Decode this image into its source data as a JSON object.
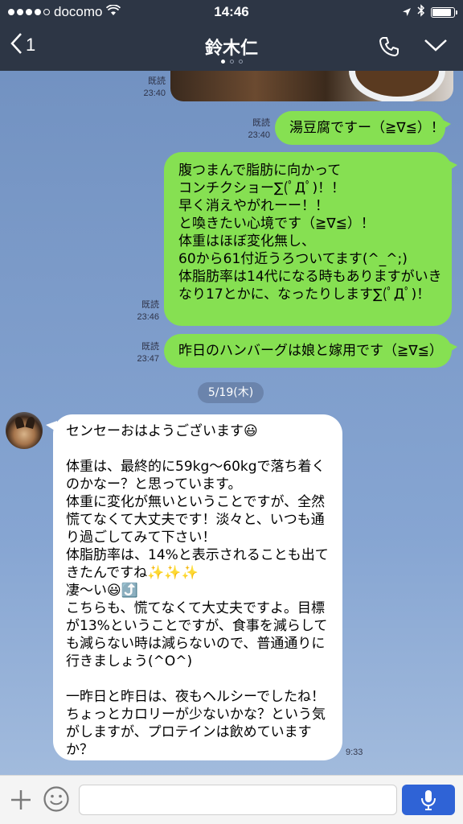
{
  "status_bar": {
    "carrier": "docomo",
    "time": "14:46",
    "signal_bars": 4,
    "signal_total": 5,
    "battery_level": 0.9
  },
  "header": {
    "back_count": "1",
    "title": "鈴木仁",
    "page_indicator": {
      "total": 3,
      "active": 0
    }
  },
  "messages": [
    {
      "read_label": "既読",
      "time": "23:40"
    },
    {
      "read_label": "既読",
      "time": "23:40",
      "text": "湯豆腐ですー（≧∇≦）！"
    },
    {
      "read_label": "既読",
      "time": "23:46",
      "text": "腹つまんで脂肪に向かって\nコンチクショー∑(ﾟДﾟ)！！\n早く消えやがれーー！！\nと喚きたい心境です（≧∇≦）！\n体重はほぼ変化無し、\n60から61付近うろついてます(^_^;)\n体脂肪率は14代になる時もありますがいき\nなり17とかに、なったりします∑(ﾟДﾟ)！"
    },
    {
      "read_label": "既読",
      "time": "23:47",
      "text": "昨日のハンバーグは娘と嫁用です（≧∇≦）"
    },
    {
      "date": "5/19(木)"
    },
    {
      "time": "9:33",
      "text": "センセーおはようございます😃\n\n体重は、最終的に59kg〜60kgで落ち着く\nのかなー？と思っています。\n体重に変化が無いということですが、全然\n慌てなくて大丈夫です！淡々と、いつも通\nり過ごしてみて下さい！\n体脂肪率は、14%と表示されることも出て\nきたんですね✨✨✨\n凄〜い😃⤴️\nこちらも、慌てなくて大丈夫ですよ。目標\nが13%ということですが、食事を減らして\nも減らない時は減らないので、普通通りに\n行きましょう(^O^)\n\n一昨日と昨日は、夜もヘルシーでしたね！\nちょっとカロリーが少ないかな？という気\nがしますが、プロテインは飲めています\nか？"
    }
  ],
  "input_bar": {
    "value": "",
    "placeholder": ""
  },
  "colors": {
    "header_bg": "#2d3645",
    "my_bubble": "#86e052",
    "their_bubble": "#ffffff",
    "chat_bg": "#7c9bc9",
    "mic_button": "#2f63d6"
  },
  "icons": {
    "back": "chevron-left-icon",
    "call": "phone-icon",
    "menu": "chevron-down-icon",
    "add": "plus-icon",
    "emoji": "smiley-icon",
    "mic": "microphone-icon",
    "wifi": "wifi-icon",
    "location": "location-arrow-icon",
    "bluetooth": "bluetooth-icon",
    "battery": "battery-icon"
  }
}
